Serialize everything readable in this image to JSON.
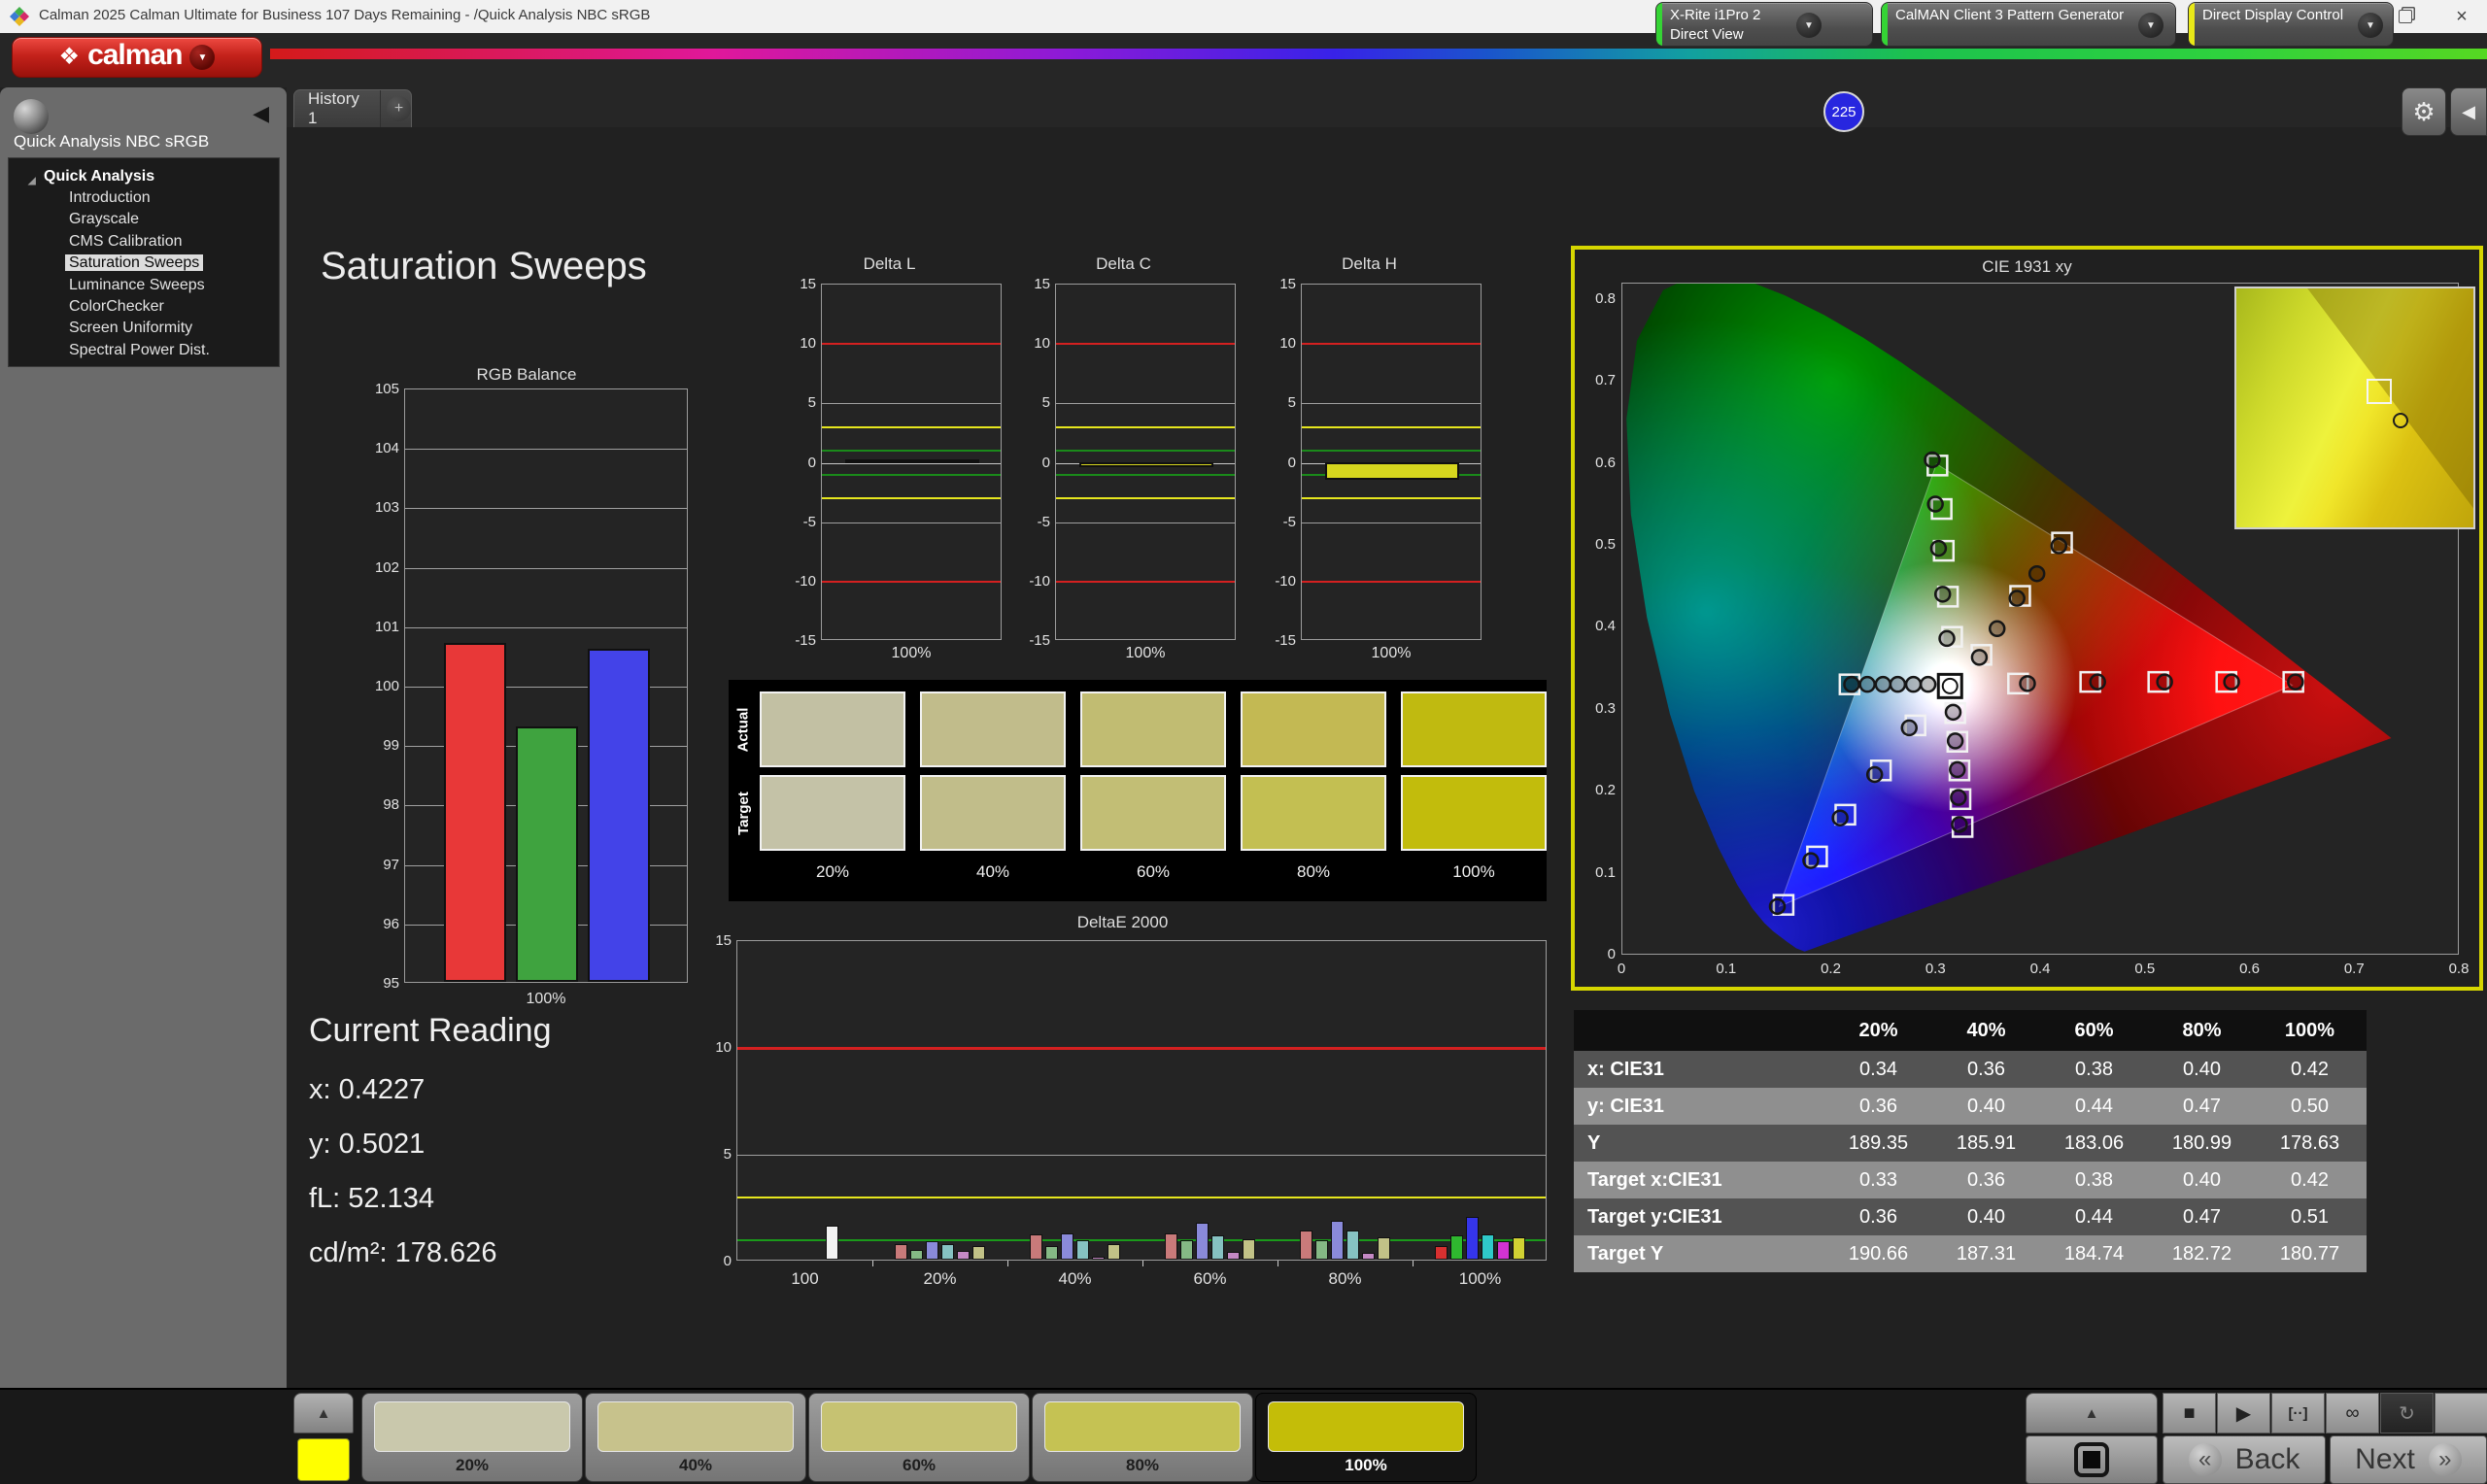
{
  "window": {
    "title": "Calman 2025 Calman Ultimate for Business 107 Days Remaining  - /Quick Analysis NBC sRGB",
    "close": "×"
  },
  "brand": {
    "logo_mark": "❖",
    "logo_text": "calman"
  },
  "tabs": {
    "history": "History 1",
    "add": "+"
  },
  "meters": {
    "meter": {
      "line1": "X-Rite i1Pro 2",
      "line2": "Direct View",
      "badge": "225",
      "edge_color": "#35d435"
    },
    "generator": {
      "label": "CalMAN Client 3 Pattern Generator",
      "edge_color": "#35d435"
    },
    "display": {
      "label": "Direct Display Control",
      "edge_color": "#e8e818"
    },
    "gear": "⚙",
    "collapse": "◀"
  },
  "sidebar": {
    "header": "Quick Analysis NBC sRGB",
    "root": "Quick Analysis",
    "items": [
      "Introduction",
      "Grayscale",
      "CMS Calibration",
      "Saturation Sweeps",
      "Luminance Sweeps",
      "ColorChecker",
      "Screen Uniformity",
      "Spectral Power Dist."
    ],
    "selected_index": 3
  },
  "page": {
    "title": "Saturation Sweeps"
  },
  "current_reading": {
    "title": "Current Reading",
    "lines": [
      "x: 0.4227",
      "y: 0.5021",
      "fL: 52.134",
      "cd/m²: 178.626"
    ]
  },
  "swatch_grid": {
    "row_labels": [
      "Actual",
      "Target"
    ],
    "col_labels": [
      "20%",
      "40%",
      "60%",
      "80%",
      "100%"
    ],
    "actual": [
      "#c2c0a3",
      "#c1bc8b",
      "#c1bc72",
      "#c3b953",
      "#c0ba10"
    ],
    "target": [
      "#c4c2a7",
      "#c1bd8a",
      "#c2be75",
      "#c3bf52",
      "#c2bc0c"
    ]
  },
  "table": {
    "headers": [
      "",
      "20%",
      "40%",
      "60%",
      "80%",
      "100%"
    ],
    "rows": [
      {
        "label": "x: CIE31",
        "values": [
          "0.34",
          "0.36",
          "0.38",
          "0.40",
          "0.42"
        ]
      },
      {
        "label": "y: CIE31",
        "values": [
          "0.36",
          "0.40",
          "0.44",
          "0.47",
          "0.50"
        ]
      },
      {
        "label": "Y",
        "values": [
          "189.35",
          "185.91",
          "183.06",
          "180.99",
          "178.63"
        ]
      },
      {
        "label": "Target x:CIE31",
        "values": [
          "0.33",
          "0.36",
          "0.38",
          "0.40",
          "0.42"
        ]
      },
      {
        "label": "Target y:CIE31",
        "values": [
          "0.36",
          "0.40",
          "0.44",
          "0.47",
          "0.51"
        ]
      },
      {
        "label": "Target Y",
        "values": [
          "190.66",
          "187.31",
          "184.74",
          "182.72",
          "180.77"
        ]
      }
    ]
  },
  "bottom_bar": {
    "up_arrow": "▲",
    "pattern_color": "#ffff00",
    "levels": [
      {
        "label": "20%",
        "color": "#c9c8ac",
        "active": false
      },
      {
        "label": "40%",
        "color": "#c7c28c",
        "active": false
      },
      {
        "label": "60%",
        "color": "#c6c272",
        "active": false
      },
      {
        "label": "80%",
        "color": "#c5c253",
        "active": false
      },
      {
        "label": "100%",
        "color": "#c4bd08",
        "active": true
      }
    ],
    "icons": [
      {
        "name": "stop-icon",
        "glyph": "■",
        "dark": false
      },
      {
        "name": "play-icon",
        "glyph": "▶",
        "dark": false
      },
      {
        "name": "step-icon",
        "glyph": "[··]",
        "dark": false
      },
      {
        "name": "loop-icon",
        "glyph": "∞",
        "dark": false
      },
      {
        "name": "refresh-icon",
        "glyph": "↻",
        "dark": true
      },
      {
        "name": "blank-icon",
        "glyph": "",
        "dark": false
      }
    ],
    "back": "Back",
    "next": "Next"
  },
  "chart_data": [
    {
      "id": "rgb_balance",
      "type": "bar",
      "title": "RGB Balance",
      "categories": [
        "Red",
        "Green",
        "Blue"
      ],
      "values": [
        100.7,
        99.3,
        100.6
      ],
      "colors": [
        "#e83838",
        "#3fa33f",
        "#4343e8"
      ],
      "ylim": [
        95,
        105
      ],
      "ytick_step": 1,
      "xlabel": "100%",
      "grid": true
    },
    {
      "id": "delta_l",
      "type": "bar",
      "title": "Delta L",
      "categories": [
        "100%"
      ],
      "values": [
        0.2
      ],
      "color": "#d6d61e",
      "ylim": [
        -15,
        15
      ],
      "yticks": [
        15,
        10,
        5,
        0,
        -5,
        -10,
        -15
      ],
      "ref_lines": [
        {
          "y": 10,
          "color": "#d42020"
        },
        {
          "y": -10,
          "color": "#d42020"
        },
        {
          "y": 3,
          "color": "#e6e61e"
        },
        {
          "y": -3,
          "color": "#e6e61e"
        },
        {
          "y": 1,
          "color": "#1a8a1a"
        },
        {
          "y": -1,
          "color": "#1a8a1a"
        }
      ],
      "xlabel": "100%"
    },
    {
      "id": "delta_c",
      "type": "bar",
      "title": "Delta C",
      "categories": [
        "100%"
      ],
      "values": [
        -0.45
      ],
      "color": "#d6d61e",
      "ylim": [
        -15,
        15
      ],
      "yticks": [
        15,
        10,
        5,
        0,
        -5,
        -10,
        -15
      ],
      "ref_lines": [
        {
          "y": 10,
          "color": "#d42020"
        },
        {
          "y": -10,
          "color": "#d42020"
        },
        {
          "y": 3,
          "color": "#e6e61e"
        },
        {
          "y": -3,
          "color": "#e6e61e"
        },
        {
          "y": 1,
          "color": "#1a8a1a"
        },
        {
          "y": -1,
          "color": "#1a8a1a"
        }
      ],
      "xlabel": "100%"
    },
    {
      "id": "delta_h",
      "type": "bar",
      "title": "Delta H",
      "categories": [
        "100%"
      ],
      "values": [
        -1.5
      ],
      "color": "#d6d61e",
      "ylim": [
        -15,
        15
      ],
      "yticks": [
        15,
        10,
        5,
        0,
        -5,
        -10,
        -15
      ],
      "ref_lines": [
        {
          "y": 10,
          "color": "#d42020"
        },
        {
          "y": -10,
          "color": "#d42020"
        },
        {
          "y": 3,
          "color": "#e6e61e"
        },
        {
          "y": -3,
          "color": "#e6e61e"
        },
        {
          "y": 1,
          "color": "#1a8a1a"
        },
        {
          "y": -1,
          "color": "#1a8a1a"
        }
      ],
      "xlabel": "100%"
    },
    {
      "id": "deltae_2000",
      "type": "bar",
      "title": "DeltaE 2000",
      "ylim": [
        0,
        15
      ],
      "yticks": [
        0,
        5,
        10,
        15
      ],
      "ref_lines": [
        {
          "y": 10,
          "color": "#d42020"
        },
        {
          "y": 3,
          "color": "#e6e61e"
        },
        {
          "y": 1,
          "color": "#1a9a1a"
        }
      ],
      "groups": [
        {
          "label": "100",
          "values": [
            1.6
          ],
          "colors": [
            "#f2f2f2"
          ]
        },
        {
          "label": "20%",
          "values": [
            0.75,
            0.45,
            0.85,
            0.75,
            0.4,
            0.65
          ],
          "colors": [
            "#c97a7a",
            "#85b985",
            "#8a8ada",
            "#86c2c2",
            "#c489c4",
            "#c2c287"
          ]
        },
        {
          "label": "40%",
          "values": [
            1.2,
            0.65,
            1.25,
            0.9,
            0.12,
            0.75
          ],
          "colors": [
            "#c97a7a",
            "#85b985",
            "#8a8ada",
            "#86c2c2",
            "#c489c4",
            "#c2c287"
          ]
        },
        {
          "label": "60%",
          "values": [
            1.25,
            0.9,
            1.75,
            1.15,
            0.35,
            0.95
          ],
          "colors": [
            "#c97a7a",
            "#85b985",
            "#8a8ada",
            "#86c2c2",
            "#c489c4",
            "#c2c287"
          ]
        },
        {
          "label": "80%",
          "values": [
            1.35,
            0.9,
            1.8,
            1.35,
            0.3,
            1.05
          ],
          "colors": [
            "#c97a7a",
            "#85b985",
            "#8a8ada",
            "#86c2c2",
            "#c489c4",
            "#c2c287"
          ]
        },
        {
          "label": "100%",
          "values": [
            0.65,
            1.15,
            2.0,
            1.2,
            0.85,
            1.05
          ],
          "colors": [
            "#d83030",
            "#2fb82f",
            "#3535ea",
            "#2fc9c9",
            "#d233d2",
            "#d2d233"
          ]
        }
      ]
    },
    {
      "id": "cie_1931",
      "type": "scatter",
      "title": "CIE 1931 xy",
      "xlim": [
        0,
        0.8
      ],
      "ylim": [
        0,
        0.82
      ],
      "xticks": [
        0,
        0.1,
        0.2,
        0.3,
        0.4,
        0.5,
        0.6,
        0.7,
        0.8
      ],
      "yticks": [
        0,
        0.1,
        0.2,
        0.3,
        0.4,
        0.5,
        0.6,
        0.7,
        0.8
      ],
      "gamut_triangle": {
        "red": [
          0.64,
          0.33
        ],
        "green": [
          0.3,
          0.6
        ],
        "blue": [
          0.15,
          0.06
        ]
      },
      "white_point": {
        "x": 0.313,
        "y": 0.329
      },
      "targets": [
        [
          0.378,
          0.332
        ],
        [
          0.447,
          0.334
        ],
        [
          0.512,
          0.334
        ],
        [
          0.577,
          0.334
        ],
        [
          0.641,
          0.334
        ],
        [
          0.301,
          0.598
        ],
        [
          0.305,
          0.545
        ],
        [
          0.307,
          0.494
        ],
        [
          0.311,
          0.438
        ],
        [
          0.315,
          0.389
        ],
        [
          0.154,
          0.062
        ],
        [
          0.186,
          0.121
        ],
        [
          0.213,
          0.172
        ],
        [
          0.247,
          0.226
        ],
        [
          0.28,
          0.281
        ],
        [
          0.318,
          0.296
        ],
        [
          0.32,
          0.261
        ],
        [
          0.322,
          0.226
        ],
        [
          0.323,
          0.191
        ],
        [
          0.325,
          0.157
        ],
        [
          0.42,
          0.504
        ],
        [
          0.38,
          0.439
        ],
        [
          0.343,
          0.367
        ],
        [
          0.217,
          0.331
        ]
      ],
      "measurements": [
        [
          0.387,
          0.332
        ],
        [
          0.454,
          0.334
        ],
        [
          0.518,
          0.334
        ],
        [
          0.582,
          0.334
        ],
        [
          0.643,
          0.334
        ],
        [
          0.296,
          0.605
        ],
        [
          0.299,
          0.551
        ],
        [
          0.302,
          0.497
        ],
        [
          0.306,
          0.441
        ],
        [
          0.31,
          0.387
        ],
        [
          0.148,
          0.06
        ],
        [
          0.18,
          0.116
        ],
        [
          0.208,
          0.168
        ],
        [
          0.241,
          0.221
        ],
        [
          0.274,
          0.278
        ],
        [
          0.316,
          0.297
        ],
        [
          0.318,
          0.262
        ],
        [
          0.32,
          0.227
        ],
        [
          0.321,
          0.193
        ],
        [
          0.322,
          0.16
        ],
        [
          0.417,
          0.5
        ],
        [
          0.396,
          0.466
        ],
        [
          0.377,
          0.436
        ],
        [
          0.358,
          0.399
        ],
        [
          0.341,
          0.364
        ],
        [
          0.219,
          0.331
        ],
        [
          0.234,
          0.331
        ],
        [
          0.249,
          0.331
        ],
        [
          0.263,
          0.331
        ],
        [
          0.278,
          0.331
        ],
        [
          0.292,
          0.331
        ]
      ]
    }
  ]
}
